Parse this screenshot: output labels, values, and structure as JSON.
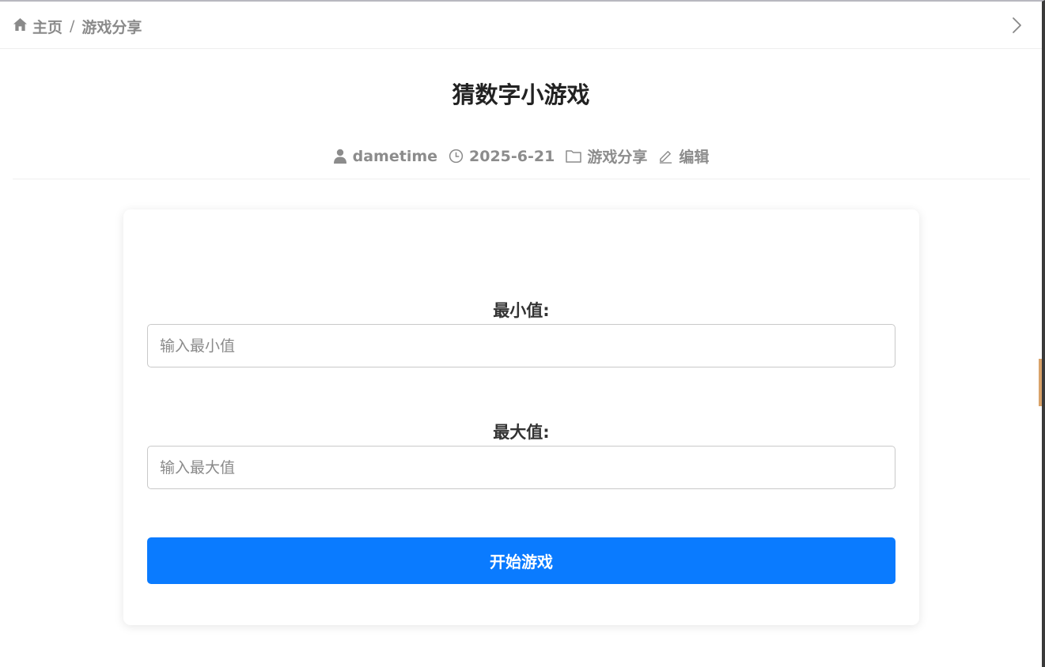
{
  "breadcrumb": {
    "home_label": "主页",
    "separator": "/",
    "current_label": "游戏分享"
  },
  "article": {
    "title": "猜数字小游戏",
    "meta": {
      "author": "dametime",
      "date": "2025-6-21",
      "category": "游戏分享",
      "edit_label": "编辑"
    }
  },
  "game_form": {
    "min_label": "最小值:",
    "min_placeholder": "输入最小值",
    "min_value": "",
    "max_label": "最大值:",
    "max_placeholder": "输入最大值",
    "max_value": "",
    "start_button": "开始游戏"
  },
  "icons": {
    "home": "home-icon",
    "chevron": "chevron-right-icon",
    "author": "user-icon",
    "date": "clock-icon",
    "category": "folder-icon",
    "edit": "edit-icon"
  },
  "colors": {
    "accent": "#0a7bff",
    "muted_text": "#8c8c8c",
    "title_text": "#222222"
  }
}
